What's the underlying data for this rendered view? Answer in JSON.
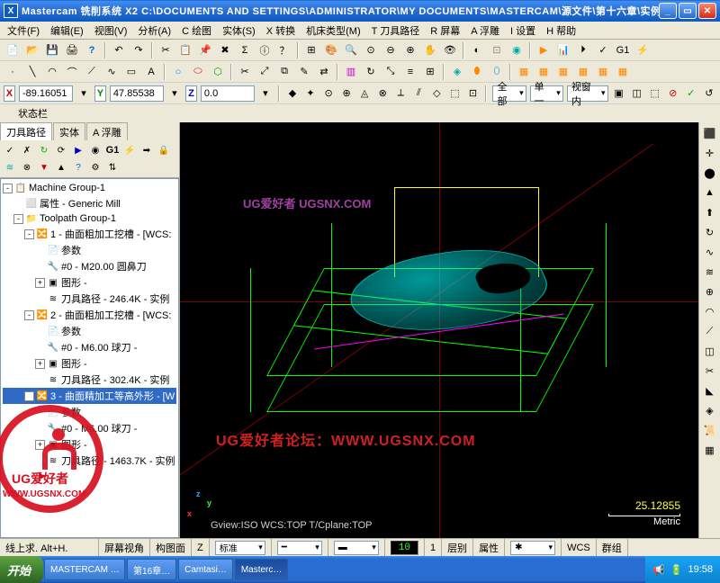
{
  "title": "Mastercam 铣削系统  X2  C:\\DOCUMENTS AND SETTINGS\\ADMINISTRATOR\\MY DOCUMENTS\\MASTERCAM\\源文件\\第十六章\\实例一.MCX",
  "menus": [
    "文件(F)",
    "编辑(E)",
    "视图(V)",
    "分析(A)",
    "C 绘图",
    "实体(S)",
    "X 转换",
    "机床类型(M)",
    "T 刀具路径",
    "R 屏幕",
    "A 浮雕",
    "I 设置",
    "H 帮助"
  ],
  "coords": {
    "x": "-89.16051",
    "y": "47.85538",
    "z": "0.0"
  },
  "combos": {
    "c1": "全部",
    "c2": "单一",
    "c3": "视窗内"
  },
  "statuslabel": "状态栏",
  "sidetabs": [
    "刀具路径",
    "实体",
    "A 浮雕"
  ],
  "tree": [
    {
      "lvl": 0,
      "exp": "-",
      "ico": "📋",
      "txt": "Machine Group-1"
    },
    {
      "lvl": 1,
      "exp": "",
      "ico": "⬜",
      "txt": "属性 - Generic Mill"
    },
    {
      "lvl": 1,
      "exp": "-",
      "ico": "📁",
      "txt": "Toolpath Group-1"
    },
    {
      "lvl": 2,
      "exp": "-",
      "ico": "🔀",
      "txt": "1 - 曲面粗加工挖槽 - [WCS:"
    },
    {
      "lvl": 3,
      "exp": "",
      "ico": "📄",
      "txt": "参数"
    },
    {
      "lvl": 3,
      "exp": "",
      "ico": "🔧",
      "txt": "#0 - M20.00 圆鼻刀"
    },
    {
      "lvl": 3,
      "exp": "+",
      "ico": "▣",
      "txt": "图形 -"
    },
    {
      "lvl": 3,
      "exp": "",
      "ico": "≋",
      "txt": "刀具路径 - 246.4K - 实例"
    },
    {
      "lvl": 2,
      "exp": "-",
      "ico": "🔀",
      "txt": "2 - 曲面粗加工挖槽 - [WCS:"
    },
    {
      "lvl": 3,
      "exp": "",
      "ico": "📄",
      "txt": "参数"
    },
    {
      "lvl": 3,
      "exp": "",
      "ico": "🔧",
      "txt": "#0 - M6.00 球刀 -"
    },
    {
      "lvl": 3,
      "exp": "+",
      "ico": "▣",
      "txt": "图形 -"
    },
    {
      "lvl": 3,
      "exp": "",
      "ico": "≋",
      "txt": "刀具路径 - 302.4K - 实例"
    },
    {
      "lvl": 2,
      "exp": "-",
      "ico": "🔀",
      "txt": "3 - 曲面精加工等高外形 - [W",
      "sel": true
    },
    {
      "lvl": 3,
      "exp": "",
      "ico": "📄",
      "txt": "参数"
    },
    {
      "lvl": 3,
      "exp": "",
      "ico": "🔧",
      "txt": "#0 - M6.00 球刀 -"
    },
    {
      "lvl": 3,
      "exp": "+",
      "ico": "▣",
      "txt": "图形 -"
    },
    {
      "lvl": 3,
      "exp": "",
      "ico": "≋",
      "txt": "刀具路径 - 1463.7K - 实例"
    },
    {
      "lvl": 2,
      "exp": "",
      "ico": "▶",
      "txt": "",
      "red": true
    }
  ],
  "viewport": {
    "watermark_top": "UG爱好者  UGSNX.COM",
    "watermark_mid": "UG爱好者论坛：WWW.UGSNX.COM",
    "info": "Gview:ISO  WCS:TOP  T/Cplane:TOP",
    "scale_num": "25.12855",
    "scale_unit": "Metric"
  },
  "statusbar": {
    "hint": "线上求.   Alt+H.",
    "items": [
      "屏幕视角",
      "构图面",
      "Z",
      "标准",
      "",
      "",
      "属性",
      "",
      "WCS",
      "群组"
    ],
    "layer": "10",
    "level": "1",
    "depth": "层别"
  },
  "taskbar": {
    "start": "开始",
    "tasks": [
      "MASTERCAM …",
      "第16章…",
      "Camtasi…",
      "Masterc…"
    ],
    "clock": "19:58"
  },
  "stamp": {
    "brand": "UG爱好者",
    "url": "WWW.UGSNX.COM"
  }
}
